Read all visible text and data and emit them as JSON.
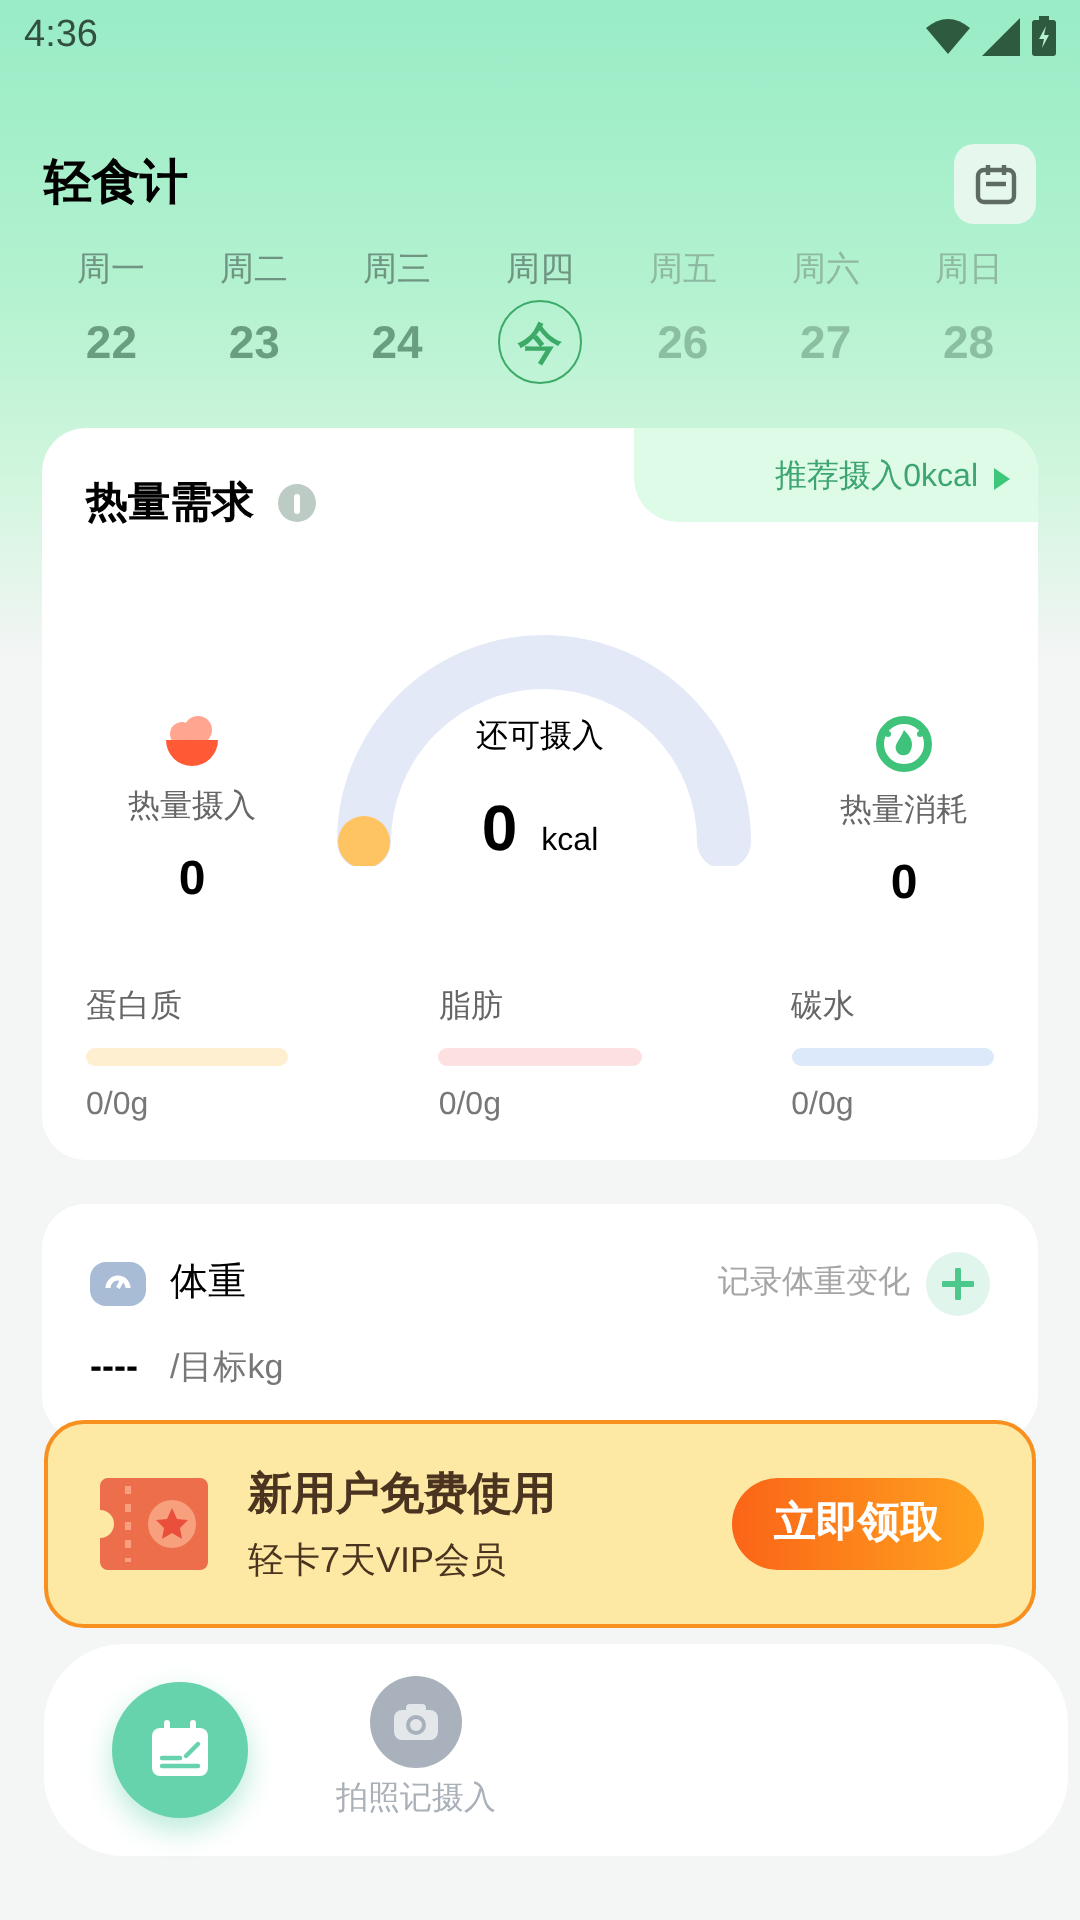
{
  "status_bar": {
    "time": "4:36"
  },
  "header": {
    "title": "轻食计"
  },
  "week": [
    {
      "label": "周一",
      "date": "22",
      "selected": false,
      "future": false
    },
    {
      "label": "周二",
      "date": "23",
      "selected": false,
      "future": false
    },
    {
      "label": "周三",
      "date": "24",
      "selected": false,
      "future": false
    },
    {
      "label": "周四",
      "date": "今",
      "selected": true,
      "future": false
    },
    {
      "label": "周五",
      "date": "26",
      "selected": false,
      "future": true
    },
    {
      "label": "周六",
      "date": "27",
      "selected": false,
      "future": true
    },
    {
      "label": "周日",
      "date": "28",
      "selected": false,
      "future": true
    }
  ],
  "calorie_card": {
    "title": "热量需求",
    "recommend": "推荐摄入0kcal",
    "remaining_label": "还可摄入",
    "remaining_value": "0",
    "remaining_unit": "kcal",
    "intake": {
      "label": "热量摄入",
      "value": "0"
    },
    "burned": {
      "label": "热量消耗",
      "value": "0"
    },
    "macros": [
      {
        "name": "蛋白质",
        "value": "0/0g",
        "color": "#fdefd0"
      },
      {
        "name": "脂肪",
        "value": "0/0g",
        "color": "#fde0e0"
      },
      {
        "name": "碳水",
        "value": "0/0g",
        "color": "#dbe9fb"
      }
    ]
  },
  "weight_card": {
    "title": "体重",
    "action": "记录体重变化",
    "value": "----",
    "target": "/目标kg"
  },
  "promo": {
    "title": "新用户免费使用",
    "subtitle": "轻卡7天VIP会员",
    "button": "立即领取"
  },
  "bottom_nav": [
    {
      "kind": "primary"
    },
    {
      "kind": "camera",
      "label": "拍照记摄入"
    }
  ]
}
